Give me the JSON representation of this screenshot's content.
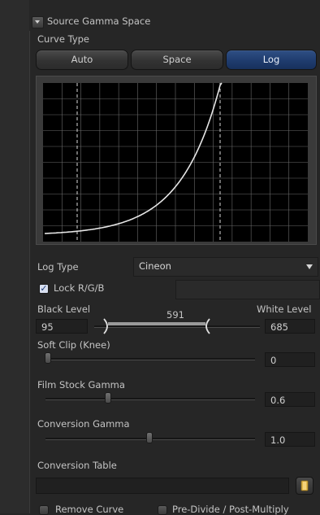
{
  "section": {
    "title": "Source Gamma Space"
  },
  "curve_type": {
    "label": "Curve Type",
    "options": [
      "Auto",
      "Space",
      "Log"
    ],
    "selected": "Log"
  },
  "log_type": {
    "label": "Log Type",
    "value": "Cineon"
  },
  "lock_rgb": {
    "label": "Lock R/G/B",
    "checked": true
  },
  "levels": {
    "black_label": "Black Level",
    "black_value": "95",
    "white_label": "White Level",
    "white_value": "685",
    "mid_value": "591"
  },
  "soft_clip": {
    "label": "Soft Clip (Knee)",
    "value": "0"
  },
  "film_stock_gamma": {
    "label": "Film Stock Gamma",
    "value": "0.6"
  },
  "conversion_gamma": {
    "label": "Conversion Gamma",
    "value": "1.0"
  },
  "conversion_table": {
    "label": "Conversion Table",
    "value": ""
  },
  "options": {
    "remove_curve": "Remove Curve",
    "pre_divide": "Pre-Divide / Post-Multiply"
  },
  "colors": {
    "accent": "#1f3c6e",
    "background": "#262626",
    "curve": "#e6e6e6",
    "marker": "#d8d8d8"
  },
  "icons": {
    "collapse": "triangle-down-icon",
    "dropdown": "triangle-down-icon",
    "browse": "folder-icon"
  }
}
